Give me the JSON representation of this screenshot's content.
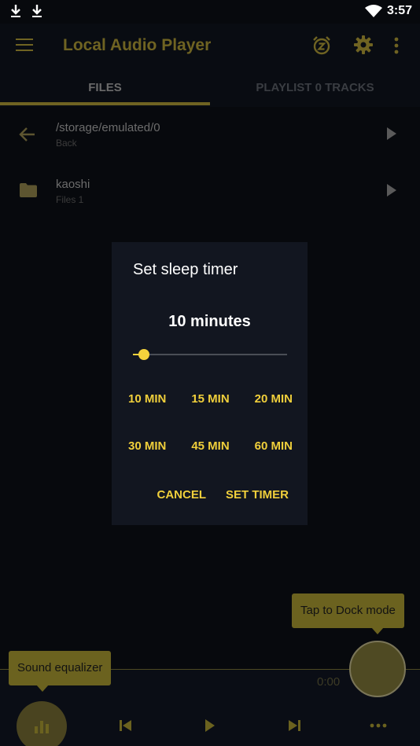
{
  "status_bar": {
    "icons": [
      "download-icon",
      "download-icon",
      "wifi-icon"
    ],
    "time": "3:57"
  },
  "app_bar": {
    "title": "Local Audio Player",
    "icons": [
      "menu-icon",
      "sleep-timer-icon",
      "settings-icon",
      "more-vert-icon"
    ]
  },
  "tabs": [
    {
      "label": "FILES",
      "active": true
    },
    {
      "label": "PLAYLIST 0 TRACKS",
      "active": false
    }
  ],
  "file_list": [
    {
      "icon": "back-arrow-icon",
      "title": "/storage/emulated/0",
      "subtitle": "Back"
    },
    {
      "icon": "folder-icon",
      "title": "kaoshi",
      "subtitle": "Files 1"
    }
  ],
  "dialog": {
    "title": "Set sleep timer",
    "value_label": "10 minutes",
    "slider": {
      "value_minutes": 10,
      "fraction": 0.07
    },
    "presets": [
      [
        "10 MIN",
        "15 MIN",
        "20 MIN"
      ],
      [
        "30 MIN",
        "45 MIN",
        "60 MIN"
      ]
    ],
    "cancel_label": "CANCEL",
    "confirm_label": "SET TIMER"
  },
  "player": {
    "time": "0:00",
    "controls": [
      "equalizer-icon",
      "skip-previous-icon",
      "play-icon",
      "skip-next-icon",
      "more-horiz-icon"
    ]
  },
  "tooltips": {
    "dock": "Tap to Dock mode",
    "equalizer": "Sound equalizer"
  },
  "colors": {
    "accent": "#f0cf3b",
    "accent_dim": "#6f6322",
    "background": "#07090d",
    "dialog_bg": "#121620"
  }
}
